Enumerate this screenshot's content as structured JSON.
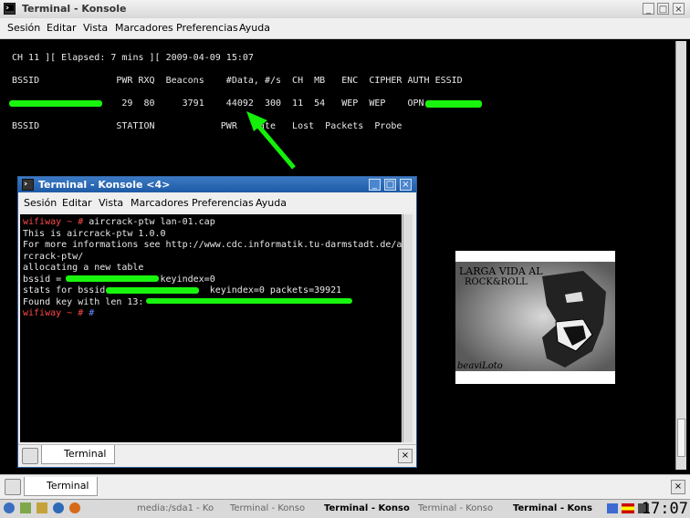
{
  "window": {
    "title": "Terminal - Konsole"
  },
  "menu": [
    "Sesión",
    "Editar",
    "Vista",
    "Marcadores",
    "Preferencias",
    "Ayuda"
  ],
  "airodump": {
    "header": "CH 11 ][ Elapsed: 7 mins ][ 2009-04-09 15:07",
    "ap_columns": "BSSID              PWR RXQ  Beacons    #Data, #/s  CH  MB   ENC  CIPHER AUTH ESSID",
    "ap_row": "                    29  80     3791    44092  300  11  54   WEP  WEP    OPN",
    "station_columns": "BSSID              STATION            PWR   Rate   Lost  Packets  Probe"
  },
  "inner_window": {
    "title": "Terminal - Konsole <4>",
    "menu": [
      "Sesión",
      "Editar",
      "Vista",
      "Marcadores",
      "Preferencias",
      "Ayuda"
    ],
    "lines": [
      {
        "prompt": "wifiway ~ #",
        "text": " aircrack-ptw lan-01.cap"
      },
      {
        "prompt": "",
        "text": "This is aircrack-ptw 1.0.0"
      },
      {
        "prompt": "",
        "text": "For more informations see http://www.cdc.informatik.tu-darmstadt.de/ai"
      },
      {
        "prompt": "",
        "text": "rcrack-ptw/"
      },
      {
        "prompt": "",
        "text": "allocating a new table"
      },
      {
        "prompt": "",
        "text": "bssid =                  keyindex=0"
      },
      {
        "prompt": "",
        "text": "stats for bssid                   keyindex=0 packets=39921"
      },
      {
        "prompt": "",
        "text": "Found key with len 13:"
      },
      {
        "prompt": "wifiway ~ #",
        "text": ""
      }
    ],
    "tab_label": "Terminal"
  },
  "tab_label": "Terminal",
  "image_panel": {
    "top_text": "LARGA VIDA AL\nROCK&ROLL",
    "sign": "beaviLoto"
  },
  "taskbar": {
    "items": [
      {
        "label": "media:/sda1 - Ko",
        "active": false
      },
      {
        "label": "Terminal - Konso",
        "active": false
      },
      {
        "label": "Terminal - Konso",
        "active": true
      },
      {
        "label": "Terminal - Konso",
        "active": false
      },
      {
        "label": "Terminal - Kons",
        "active": true
      }
    ],
    "clock": "17:07"
  }
}
